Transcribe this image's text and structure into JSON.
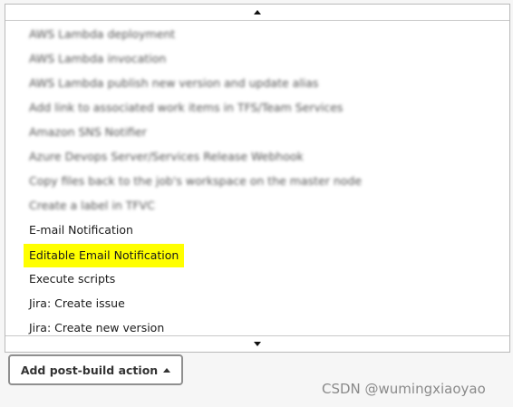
{
  "dropdown": {
    "scroll_up_icon": "up-arrow-icon",
    "scroll_down_icon": "down-arrow-icon",
    "items": [
      {
        "label": "AWS Lambda deployment",
        "blurred": true
      },
      {
        "label": "AWS Lambda invocation",
        "blurred": true
      },
      {
        "label": "AWS Lambda publish new version and update alias",
        "blurred": true
      },
      {
        "label": "Add link to associated work items in TFS/Team Services",
        "blurred": true
      },
      {
        "label": "Amazon SNS Notifier",
        "blurred": true
      },
      {
        "label": "Azure Devops Server/Services Release Webhook",
        "blurred": true
      },
      {
        "label": "Copy files back to the job's workspace on the master node",
        "blurred": true
      },
      {
        "label": "Create a label in TFVC",
        "blurred": true
      },
      {
        "label": "E-mail Notification",
        "blurred": false
      },
      {
        "label": "Editable Email Notification",
        "blurred": false,
        "highlighted": true
      },
      {
        "label": "Execute scripts",
        "blurred": false
      },
      {
        "label": "Jira: Create issue",
        "blurred": false
      },
      {
        "label": "Jira: Create new version",
        "blurred": false
      }
    ]
  },
  "add_action_button": {
    "label": "Add post-build action",
    "icon": "caret-up-icon"
  },
  "watermark": "CSDN @wumingxiaoyao",
  "colors": {
    "highlight": "#ffff00",
    "background": "#f6f6f6"
  }
}
